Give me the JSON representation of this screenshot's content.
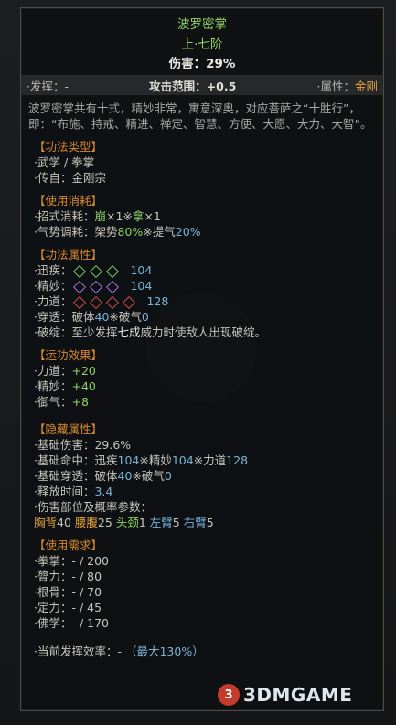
{
  "header": {
    "title": "波罗密掌",
    "grade": "上·七阶",
    "damage": "伤害：29%"
  },
  "topbar": {
    "fafa_label": "·发挥：",
    "fafa_value": "-",
    "range_label": "攻击范围：",
    "range_value": "+0.5",
    "attr_label": "·属性：",
    "attr_value": "金刚"
  },
  "description": "波罗密掌共有十式，精妙非常，寓意深奥，对应菩萨之“十胜行”，即：“布施、持戒、精进、禅定、智慧、方便、大愿、大力、大智”。",
  "type_section": {
    "title": "【功法类型】",
    "line1": "·武学 / 拳掌",
    "line2": "·传自：金刚宗"
  },
  "cost_section": {
    "title": "【使用消耗】",
    "move_label": "·招式消耗：",
    "move_a": "崩",
    "move_b": "×1※",
    "move_c": "拿",
    "move_d": "×1",
    "qi_label": "·气势调耗：",
    "qi_a": "架势",
    "qi_b": "80%",
    "qi_c": "※提气",
    "qi_d": "20%"
  },
  "attr_section": {
    "title": "【功法属性】",
    "rows": [
      {
        "label": "·迅疾：",
        "value": "104"
      },
      {
        "label": "·精妙：",
        "value": "104"
      },
      {
        "label": "·力道：",
        "value": "128"
      }
    ],
    "pen_label": "·穿透：",
    "pen_a": "破体",
    "pen_b": "40",
    "pen_c": "※破气",
    "pen_d": "0",
    "break_label": "·破绽：",
    "break_a": "至少发挥",
    "break_b": "七成",
    "break_c": "威力时使敌人出现破绽。"
  },
  "effect_section": {
    "title": "【运功效果】",
    "rows": [
      {
        "label": "·力道：",
        "value": "+20"
      },
      {
        "label": "·精妙：",
        "value": "+40"
      },
      {
        "label": "·御气：",
        "value": "+8"
      }
    ]
  },
  "hidden_section": {
    "title": "【隐藏属性】",
    "base_dmg": "·基础伤害：29.6%",
    "hit_label": "·基础命中：",
    "hit_a": "迅疾",
    "hit_b": "104",
    "hit_c": "※精妙",
    "hit_d": "104",
    "hit_e": "※力道",
    "hit_f": "128",
    "pen_label": "·基础穿透：",
    "pen_a": "破体",
    "pen_b": "40",
    "pen_c": "※破气",
    "pen_d": "0",
    "release_label": "·释放时间：",
    "release_value": "3.4",
    "parts_label": "·伤害部位及概率参数：",
    "parts": [
      {
        "name": "胸背",
        "value": "40"
      },
      {
        "name": "腰腹",
        "value": "25"
      },
      {
        "name": "头颈",
        "value": "1"
      },
      {
        "name": "左臂",
        "value": "5"
      },
      {
        "name": "右臂",
        "value": "5"
      }
    ]
  },
  "req_section": {
    "title": "【使用需求】",
    "rows": [
      {
        "label": "·拳掌：",
        "value": "- / 200"
      },
      {
        "label": "·膂力：",
        "value": "- / 80"
      },
      {
        "label": "·根骨：",
        "value": "- / 70"
      },
      {
        "label": "·定力：",
        "value": "- / 45"
      },
      {
        "label": "·佛学：",
        "value": "- / 170"
      }
    ]
  },
  "efficiency": {
    "label": "·当前发挥效率：",
    "value": "-",
    "max": "（最大130%）"
  },
  "watermark": {
    "mark": "3",
    "text": "3DMGAME"
  },
  "colors": {
    "green": "#8fd064",
    "blue": "#7ab3d8",
    "orange": "#e0a23c",
    "red": "#c54f4f"
  }
}
